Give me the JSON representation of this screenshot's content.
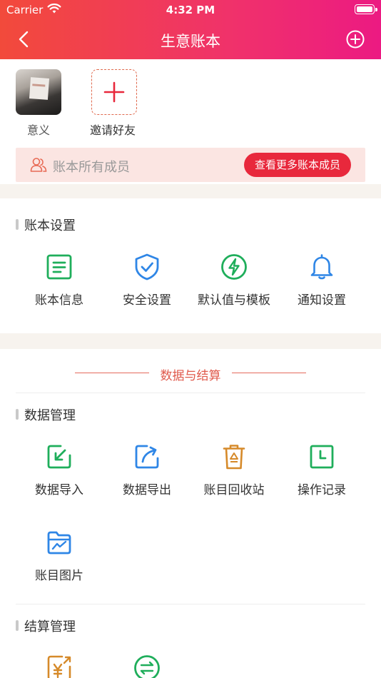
{
  "status_bar": {
    "carrier": "Carrier",
    "time": "4:32 PM"
  },
  "nav": {
    "title": "生意账本",
    "back_icon": "chevron-left-icon",
    "add_icon": "plus-circle-icon"
  },
  "members": {
    "list": [
      {
        "name": "意义"
      }
    ],
    "invite_label": "邀请好友",
    "bar_label": "账本所有成员",
    "more_button": "查看更多账本成员"
  },
  "ledger_settings": {
    "title": "账本设置",
    "items": [
      {
        "label": "账本信息",
        "icon": "document-icon",
        "color": "#1fae5b"
      },
      {
        "label": "安全设置",
        "icon": "shield-check-icon",
        "color": "#2f86e6"
      },
      {
        "label": "默认值与模板",
        "icon": "lightning-icon",
        "color": "#1fae5b"
      },
      {
        "label": "通知设置",
        "icon": "bell-icon",
        "color": "#2f86e6"
      }
    ]
  },
  "data_section": {
    "divider_title": "数据与结算",
    "management_title": "数据管理",
    "items": [
      {
        "label": "数据导入",
        "icon": "import-icon",
        "color": "#1fae5b"
      },
      {
        "label": "数据导出",
        "icon": "export-icon",
        "color": "#2f86e6"
      },
      {
        "label": "账目回收站",
        "icon": "recycle-bin-icon",
        "color": "#d68a2a"
      },
      {
        "label": "操作记录",
        "icon": "clock-record-icon",
        "color": "#1fae5b"
      },
      {
        "label": "账目图片",
        "icon": "image-folder-icon",
        "color": "#2f86e6"
      }
    ],
    "settlement_title": "结算管理",
    "settlement_items": [
      {
        "icon": "yuan-settlement-icon",
        "color": "#d68a2a"
      },
      {
        "icon": "transfer-icon",
        "color": "#1fae5b"
      }
    ]
  }
}
